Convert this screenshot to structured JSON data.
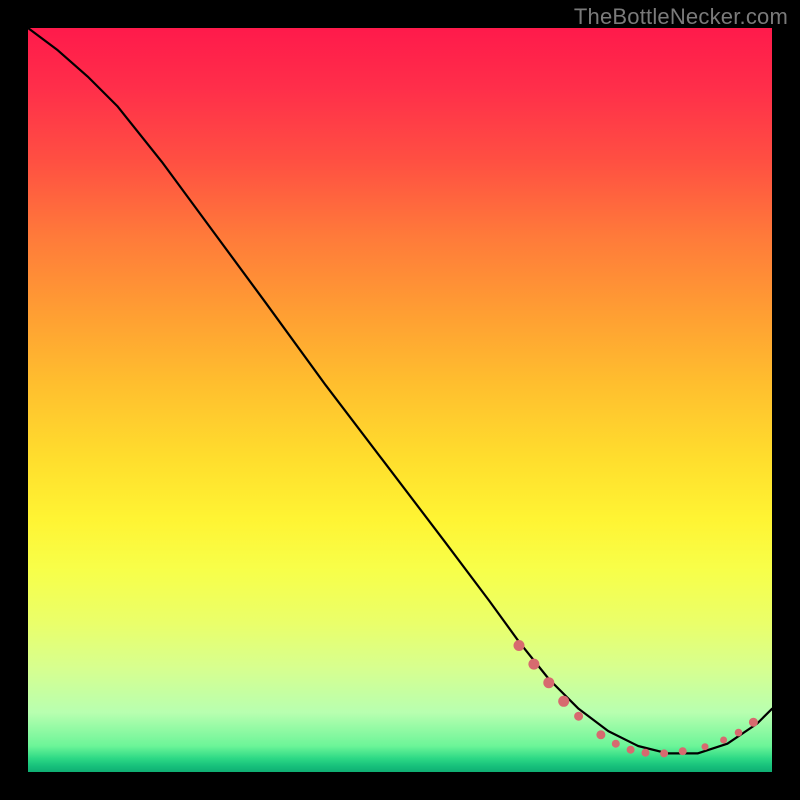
{
  "watermark": "TheBottleNecker.com",
  "chart_data": {
    "type": "line",
    "title": "",
    "xlabel": "",
    "ylabel": "",
    "xlim": [
      0,
      100
    ],
    "ylim": [
      0,
      100
    ],
    "grid": false,
    "series": [
      {
        "name": "curve",
        "color": "#000000",
        "x": [
          0,
          4,
          8,
          12,
          18,
          25,
          32,
          40,
          48,
          56,
          62,
          66,
          70,
          74,
          78,
          82,
          86,
          90,
          94,
          98,
          100
        ],
        "y": [
          100,
          97,
          93.5,
          89.5,
          82,
          72.5,
          63,
          52,
          41.5,
          31,
          23,
          17.5,
          12.5,
          8.5,
          5.5,
          3.5,
          2.5,
          2.5,
          3.8,
          6.5,
          8.5
        ]
      }
    ],
    "markers": [
      {
        "x": 66,
        "y": 17,
        "r": 5.5
      },
      {
        "x": 68,
        "y": 14.5,
        "r": 5.5
      },
      {
        "x": 70,
        "y": 12,
        "r": 5.5
      },
      {
        "x": 72,
        "y": 9.5,
        "r": 5.5
      },
      {
        "x": 74,
        "y": 7.5,
        "r": 4.5
      },
      {
        "x": 77,
        "y": 5,
        "r": 4.5
      },
      {
        "x": 79,
        "y": 3.8,
        "r": 4
      },
      {
        "x": 81,
        "y": 3.0,
        "r": 4
      },
      {
        "x": 83,
        "y": 2.6,
        "r": 4
      },
      {
        "x": 85.5,
        "y": 2.5,
        "r": 4
      },
      {
        "x": 88,
        "y": 2.8,
        "r": 4
      },
      {
        "x": 91,
        "y": 3.4,
        "r": 3.5
      },
      {
        "x": 93.5,
        "y": 4.3,
        "r": 3.5
      },
      {
        "x": 95.5,
        "y": 5.3,
        "r": 3.8
      },
      {
        "x": 97.5,
        "y": 6.7,
        "r": 4.5
      }
    ],
    "marker_color": "#d76a6f",
    "background_gradient": {
      "top": "#ff1a4b",
      "mid": "#ffde2d",
      "bottom": "#0fae73"
    }
  }
}
